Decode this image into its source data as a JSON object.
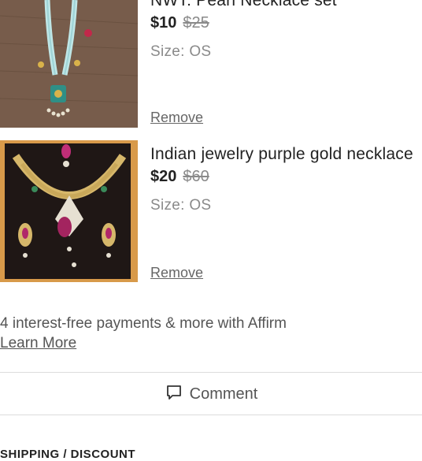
{
  "items": [
    {
      "title": "NWT: Pearl Necklace set",
      "price": "$10",
      "original_price": "$25",
      "size": "Size: OS",
      "remove_label": "Remove"
    },
    {
      "title": "Indian jewelry purple gold necklace",
      "price": "$20",
      "original_price": "$60",
      "size": "Size: OS",
      "remove_label": "Remove"
    }
  ],
  "affirm": {
    "text": "4 interest-free payments & more with Affirm",
    "link": "Learn More"
  },
  "comment_label": "Comment",
  "section_heading": "SHIPPING / DISCOUNT"
}
